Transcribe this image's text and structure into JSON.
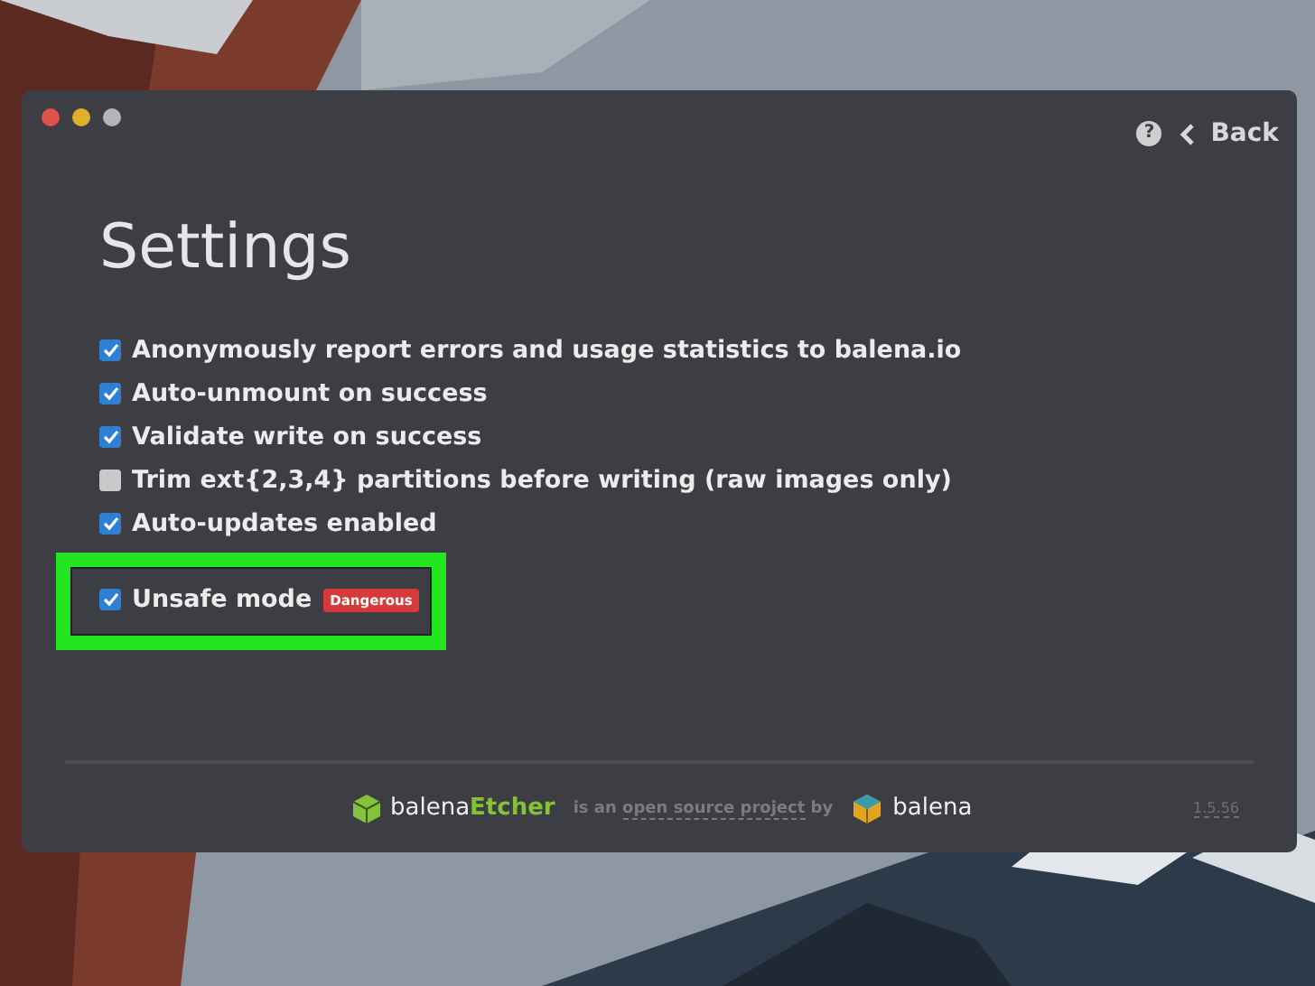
{
  "window": {
    "controls": [
      {
        "kind": "close"
      },
      {
        "kind": "minimize"
      },
      {
        "kind": "zoom"
      }
    ],
    "help": {
      "label": "?"
    },
    "back": {
      "label": "Back"
    }
  },
  "title": "Settings",
  "settings": [
    {
      "label": "Anonymously report errors and usage statistics to balena.io",
      "checked": true
    },
    {
      "label": "Auto-unmount on success",
      "checked": true
    },
    {
      "label": "Validate write on success",
      "checked": true
    },
    {
      "label": "Trim ext{2,3,4} partitions before writing (raw images only)",
      "checked": false
    },
    {
      "label": "Auto-updates enabled",
      "checked": true
    },
    {
      "label": "Unsafe mode",
      "checked": true,
      "badge": "Dangerous",
      "highlighted": true
    }
  ],
  "footer": {
    "app_name": {
      "prefix": "balena",
      "suffix": "Etcher"
    },
    "text_before": "is an",
    "link": "open source project",
    "text_after": "by",
    "company": "balena",
    "version": "1.5.56"
  }
}
